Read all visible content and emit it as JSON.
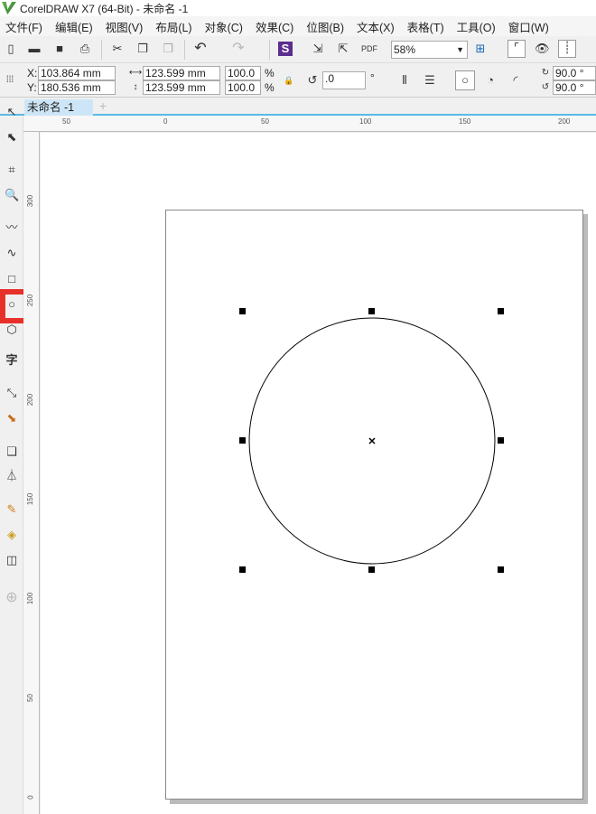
{
  "title": "CorelDRAW X7 (64-Bit) - 未命名 -1",
  "menu": [
    "文件(F)",
    "编辑(E)",
    "视图(V)",
    "布局(L)",
    "对象(C)",
    "效果(C)",
    "位图(B)",
    "文本(X)",
    "表格(T)",
    "工具(O)",
    "窗口(W)"
  ],
  "toolbar": {
    "zoom": "58%"
  },
  "props": {
    "x_label": "X:",
    "x": "103.864 mm",
    "y_label": "Y:",
    "y": "180.536 mm",
    "w": "123.599 mm",
    "h": "123.599 mm",
    "sx": "100.0",
    "sy": "100.0",
    "pct": "%",
    "rotation": ".0",
    "deg": "°",
    "start_angle": "90.0 °",
    "end_angle": "90.0 °"
  },
  "doc_tab": "未命名 -1",
  "hruler": [
    "50",
    "0",
    "50",
    "100",
    "150",
    "200"
  ],
  "vruler": [
    "300",
    "250",
    "200",
    "150",
    "100",
    "50",
    "0"
  ],
  "highlight_color": "#e8302a",
  "selected_tool": "ellipse-tool"
}
